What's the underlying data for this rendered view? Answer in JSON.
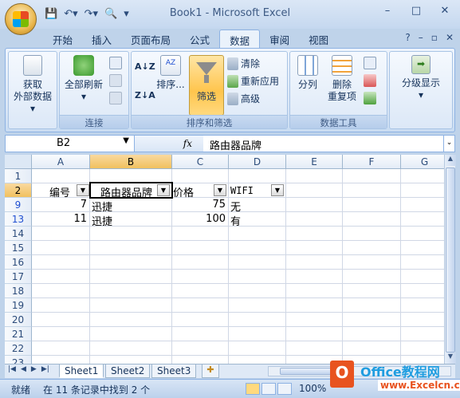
{
  "window": {
    "title": "Book1 - Microsoft Excel",
    "minimize": "–",
    "maximize": "□",
    "close": "✕"
  },
  "qat": {
    "save": "💾",
    "undo": "↶▾",
    "redo": "↷▾",
    "preview": "🔍",
    "more": "▾"
  },
  "tabs": [
    "开始",
    "插入",
    "页面布局",
    "公式",
    "数据",
    "审阅",
    "视图"
  ],
  "active_tab": "数据",
  "ribbon_controls": {
    "help": "?",
    "minimize": "–",
    "restore": "▫",
    "close": "✕"
  },
  "ribbon": {
    "get_external": {
      "line1": "获取",
      "line2": "外部数据 ▾"
    },
    "connections": {
      "refresh_all_1": "全部刷新",
      "refresh_all_2": "▾",
      "label": "连接"
    },
    "sort_filter": {
      "sort": "排序...",
      "filter": "筛选",
      "clear": "清除",
      "reapply": "重新应用",
      "advanced": "高级",
      "label": "排序和筛选"
    },
    "data_tools": {
      "split": "分列",
      "remove_dup_1": "删除",
      "remove_dup_2": "重复项",
      "label": "数据工具"
    },
    "outline": {
      "label1": "分级显示",
      "label2": "▾"
    }
  },
  "formula_bar": {
    "name_box": "B2",
    "fx": "fx",
    "content": "路由器品牌"
  },
  "columns": [
    "A",
    "B",
    "C",
    "D",
    "E",
    "F",
    "G"
  ],
  "selected_column": "B",
  "rows": [
    "1",
    "2",
    "9",
    "13",
    "14",
    "15",
    "16",
    "17",
    "18",
    "19",
    "20",
    "21",
    "22",
    "23"
  ],
  "selected_row": "2",
  "filtered_rows": [
    "9",
    "13"
  ],
  "header_row": {
    "a": "编号",
    "b": "路由器品牌",
    "c": "价格",
    "d": "WIFI"
  },
  "data_rows": [
    {
      "a": "7",
      "b": "迅捷",
      "c": "75",
      "d": "无"
    },
    {
      "a": "11",
      "b": "迅捷",
      "c": "100",
      "d": "有"
    }
  ],
  "sheets": [
    "Sheet1",
    "Sheet2",
    "Sheet3"
  ],
  "active_sheet": "Sheet1",
  "status": {
    "ready": "就绪",
    "message": "在 11 条记录中找到 2 个",
    "zoom": "100%"
  },
  "watermark": {
    "text1": "Office教程网",
    "text2": "www.Excelcn.com"
  }
}
